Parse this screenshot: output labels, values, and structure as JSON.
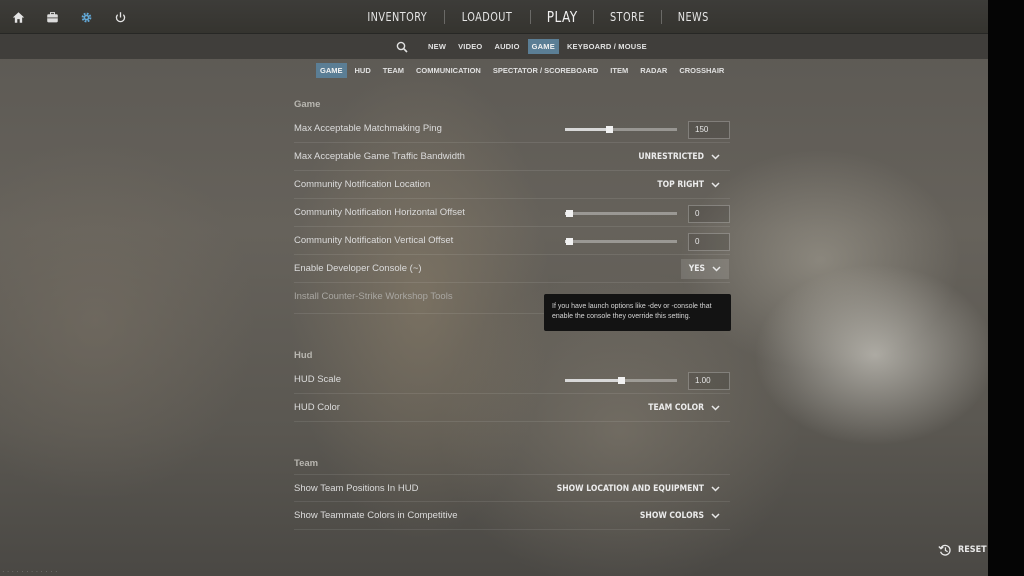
{
  "topbar": {
    "icons": [
      "home-icon",
      "inventory-case-icon",
      "settings-gear-icon",
      "power-icon"
    ],
    "nav": [
      "INVENTORY",
      "LOADOUT",
      "PLAY",
      "STORE",
      "NEWS"
    ]
  },
  "subnav": {
    "items": [
      "NEW",
      "VIDEO",
      "AUDIO",
      "GAME",
      "KEYBOARD / MOUSE"
    ],
    "active": "GAME"
  },
  "catnav": {
    "items": [
      "GAME",
      "HUD",
      "TEAM",
      "COMMUNICATION",
      "SPECTATOR / SCOREBOARD",
      "ITEM",
      "RADAR",
      "CROSSHAIR"
    ],
    "active": "GAME"
  },
  "sections": {
    "game": {
      "title": "Game",
      "ping": {
        "label": "Max Acceptable Matchmaking Ping",
        "value": "150",
        "slider_fraction": 0.39
      },
      "bandwidth": {
        "label": "Max Acceptable Game Traffic Bandwidth",
        "value": "UNRESTRICTED"
      },
      "notif_location": {
        "label": "Community Notification Location",
        "value": "TOP RIGHT"
      },
      "notif_h_offset": {
        "label": "Community Notification Horizontal Offset",
        "value": "0",
        "slider_fraction": 0.04
      },
      "notif_v_offset": {
        "label": "Community Notification Vertical Offset",
        "value": "0",
        "slider_fraction": 0.04
      },
      "dev_console": {
        "label": "Enable Developer Console (~)",
        "value": "YES"
      },
      "workshop_tools": {
        "label": "Install Counter-Strike Workshop Tools"
      }
    },
    "hud": {
      "title": "Hud",
      "scale": {
        "label": "HUD Scale",
        "value": "1.00",
        "slider_fraction": 0.5
      },
      "color": {
        "label": "HUD Color",
        "value": "TEAM COLOR"
      }
    },
    "team": {
      "title": "Team",
      "positions": {
        "label": "Show Team Positions In HUD",
        "value": "SHOW LOCATION AND EQUIPMENT"
      },
      "teammate_colors": {
        "label": "Show Teammate Colors in Competitive",
        "value": "SHOW COLORS"
      }
    }
  },
  "tooltip": {
    "text": "If you have launch options like -dev or -console that enable the console they override this setting."
  },
  "reset": {
    "label": "RESET"
  }
}
